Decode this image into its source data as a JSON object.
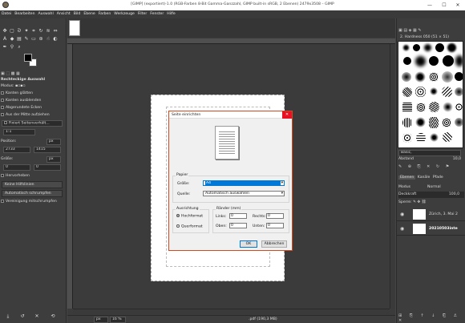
{
  "window": {
    "title": "[GIMP] (exportiert)-1.0 (RGB-Farben 8-Bit Gamma-Ganzzahl, GIMP built-in sRGB, 2 Ebenen) 2479x3508 – GIMP",
    "controls": [
      "—",
      "☐",
      "✕"
    ]
  },
  "menubar": [
    "Datei",
    "Bearbeiten",
    "Auswahl",
    "Ansicht",
    "Bild",
    "Ebene",
    "Farben",
    "Werkzeuge",
    "Filter",
    "Fenster",
    "Hilfe"
  ],
  "tool_options": {
    "title": "Rechteckige Auswahl",
    "modus_label": "Modus:",
    "kanten_glaetten": "Kanten glätten",
    "kanten_ausblenden": "Kanten ausblenden",
    "abgerundete_ecken": "Abgerundete Ecken",
    "aus_der_mitte": "Aus der Mitte aufziehen",
    "fixiert": "Fixiert Seitenverhält...",
    "ratio": "1:1",
    "position_label": "Position:",
    "position_unit": "px",
    "pos_x": "2733",
    "pos_y": "1415",
    "groesse_label": "Größe:",
    "groesse_unit": "px",
    "size_w": "0",
    "size_h": "0",
    "hervorheben": "Hervorheben",
    "hilfslinien": "Keine Hilfslinien",
    "auto_schrumpfen": "Automatisch schrumpfen",
    "vereinigung": "Vereinigung mitschrumpfen"
  },
  "dialog": {
    "title": "Seite einrichten",
    "papier_label": "Papier",
    "groesse_label": "Größe:",
    "groesse_value": "A4",
    "quelle_label": "Quelle:",
    "quelle_value": "Automatisch auswählen",
    "ausrichtung_label": "Ausrichtung",
    "hochformat": "Hochformat",
    "querformat": "Querformat",
    "raender_label": "Ränder (mm)",
    "links_label": "Links:",
    "links_value": "0",
    "rechts_label": "Rechts:",
    "rechts_value": "0",
    "oben_label": "Oben:",
    "oben_value": "0",
    "unten_label": "Unten:",
    "unten_value": "0",
    "ok_label": "OK",
    "abbrechen_label": "Abbrechen"
  },
  "statusbar": {
    "unit": "px",
    "zoom": "16 %",
    "file_info": ".pdf (190,3 MB)"
  },
  "brushes": {
    "header": "2. Hardness 050 (51 × 51)",
    "filter_label": "Basic,",
    "spacing_label": "Abstand",
    "spacing_value": "10,0"
  },
  "layers": {
    "tabs": [
      "Ebenen",
      "Kanäle",
      "Pfade"
    ],
    "modus_label": "Modus",
    "modus_value": "Normal",
    "deckkraft_label": "Deckkraft",
    "deckkraft_value": "100,0",
    "sperre_label": "Sperre:",
    "items": [
      {
        "name": "Zürich, 3. Mai 2"
      },
      {
        "name": "20210503inte"
      }
    ]
  },
  "colors": {
    "accent": "#d24a1e",
    "selection_blue": "#0078d7"
  }
}
